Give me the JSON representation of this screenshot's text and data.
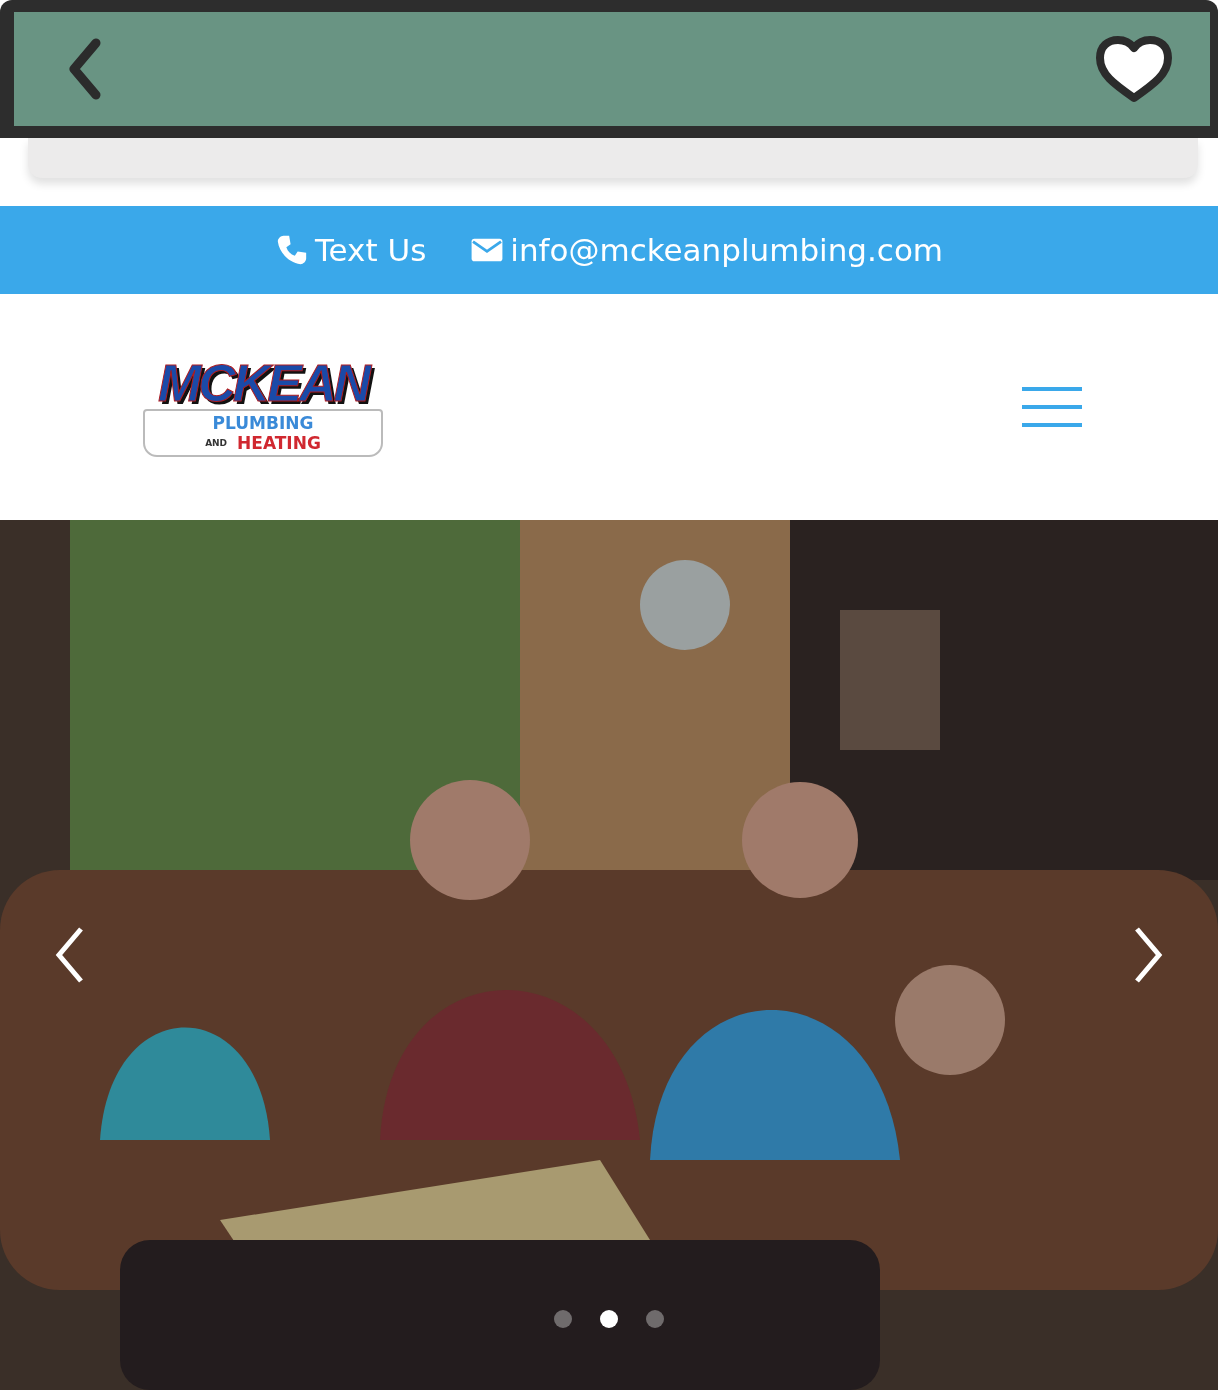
{
  "contact_bar": {
    "phone_label": "Text Us",
    "email": "info@mckeanplumbing.com"
  },
  "logo": {
    "name": "MCKEAN",
    "line_1": "PLUMBING",
    "line_2_small": "AND",
    "line_2": "HEATING"
  },
  "slider": {
    "kind": "picture",
    "dots": [
      {
        "selected": false
      },
      {
        "selected": true
      },
      {
        "selected": false
      }
    ]
  }
}
